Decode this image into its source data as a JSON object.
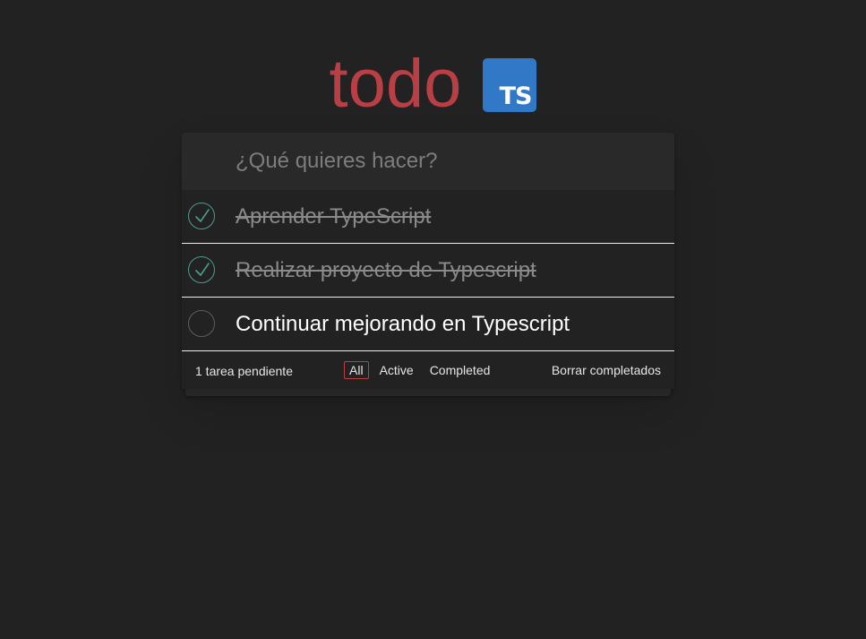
{
  "header": {
    "title": "todo",
    "logo_text": "TS",
    "logo_icon": "typescript-logo-icon"
  },
  "new_todo": {
    "placeholder": "¿Qué quieres hacer?",
    "value": ""
  },
  "todos": [
    {
      "label": "Aprender TypeScript",
      "completed": true
    },
    {
      "label": "Realizar proyecto de Typescript",
      "completed": true
    },
    {
      "label": "Continuar mejorando en Typescript",
      "completed": false
    }
  ],
  "footer": {
    "count_text": "1 tarea pendiente",
    "filters": [
      {
        "label": "All",
        "selected": true
      },
      {
        "label": "Active",
        "selected": false
      },
      {
        "label": "Completed",
        "selected": false
      }
    ],
    "clear_label": "Borrar completados"
  },
  "colors": {
    "background": "#222222",
    "title": "#b83f45",
    "ts_blue": "#3178c6",
    "check": "#4d9c8e",
    "selected_border": "#b83f45"
  }
}
